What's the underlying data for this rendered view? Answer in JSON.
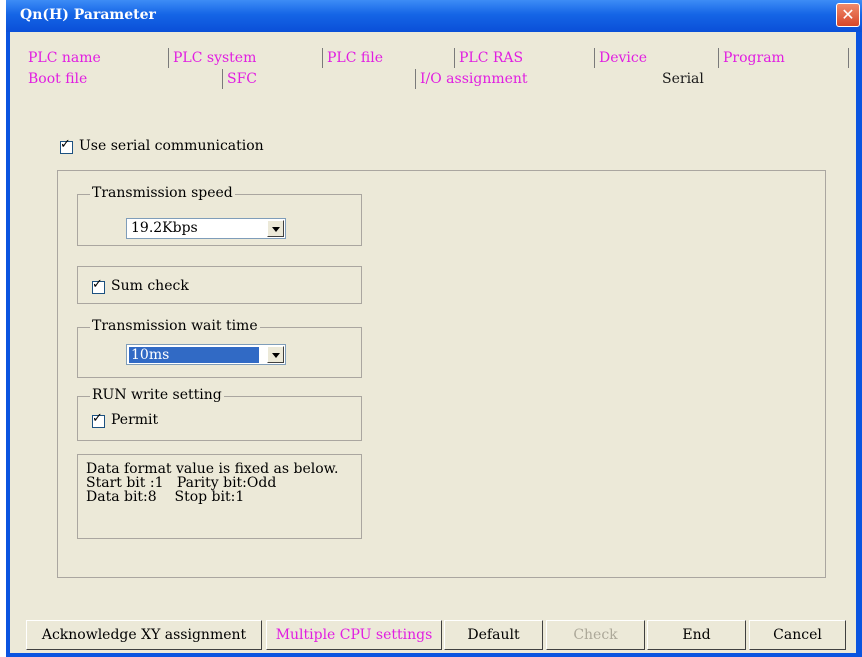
{
  "window": {
    "title": "Qn(H) Parameter",
    "close_glyph": "✕"
  },
  "tabs_row1": [
    "PLC name",
    "PLC system",
    "PLC file",
    "PLC RAS",
    "Device",
    "Program"
  ],
  "tabs_row2": [
    "Boot file",
    "SFC",
    "I/O assignment",
    "Serial"
  ],
  "serial": {
    "use_serial_label": "Use serial communication",
    "transmission_speed_title": "Transmission speed",
    "transmission_speed_value": "19.2Kbps",
    "sum_check_label": "Sum check",
    "wait_time_title": "Transmission wait time",
    "wait_time_value": "10ms",
    "run_write_title": "RUN write setting",
    "permit_label": "Permit",
    "info_line1": "Data format value is fixed as below.",
    "info_line2": "Start bit :1   Parity bit:Odd",
    "info_line3": "Data bit:8    Stop bit:1"
  },
  "buttons": {
    "ack_xy": "Acknowledge XY assignment",
    "multi_cpu": "Multiple CPU settings",
    "default": "Default",
    "check": "Check",
    "end": "End",
    "cancel": "Cancel"
  },
  "check_glyph": "✓",
  "icons": {
    "close": "close-icon",
    "dropdown": "chevron-down-icon",
    "checkmark": "checkmark-icon"
  },
  "colors": {
    "title_bar": "#0a54e0",
    "tab_text": "#e11ee1",
    "dialog_bg": "#ece9d8",
    "selection": "#316ac5"
  }
}
